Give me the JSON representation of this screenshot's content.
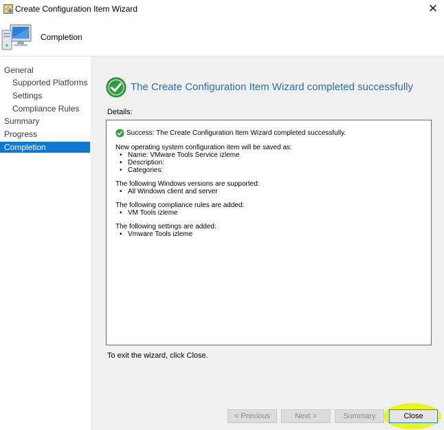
{
  "window": {
    "title": "Create Configuration Item Wizard",
    "close_glyph": "✕"
  },
  "header": {
    "title": "Completion"
  },
  "nav": {
    "items": [
      {
        "label": "General"
      },
      {
        "label": "Supported Platforms"
      },
      {
        "label": "Settings"
      },
      {
        "label": "Compliance Rules"
      },
      {
        "label": "Summary"
      },
      {
        "label": "Progress"
      },
      {
        "label": "Completion"
      }
    ]
  },
  "main": {
    "heading": "The Create Configuration Item Wizard completed successfully",
    "details_label": "Details:",
    "details": {
      "success": "Success: The Create Configuration Item Wizard completed successfully.",
      "saved_intro": "New operating system configuration item will be saved as:",
      "saved_items": [
        "Name: VMware Tools Service izleme",
        "Description:",
        "Categories:"
      ],
      "windows_intro": "The following Windows versions are supported:",
      "windows_items": [
        "All Windows client and server"
      ],
      "rules_intro": "The following compliance rules are added:",
      "rules_items": [
        "VM Tools izleme"
      ],
      "settings_intro": "The following settings are added:",
      "settings_items": [
        "Vmware Tools izleme"
      ]
    },
    "exit_text": "To exit the wizard, click Close."
  },
  "buttons": {
    "previous": "< Previous",
    "next": "Next >",
    "summary": "Summary",
    "close": "Close"
  },
  "colors": {
    "accent": "#0e78d4",
    "heading": "#2b6cb0",
    "success_green": "#2e9e3f",
    "highlight": "#e9f700"
  }
}
